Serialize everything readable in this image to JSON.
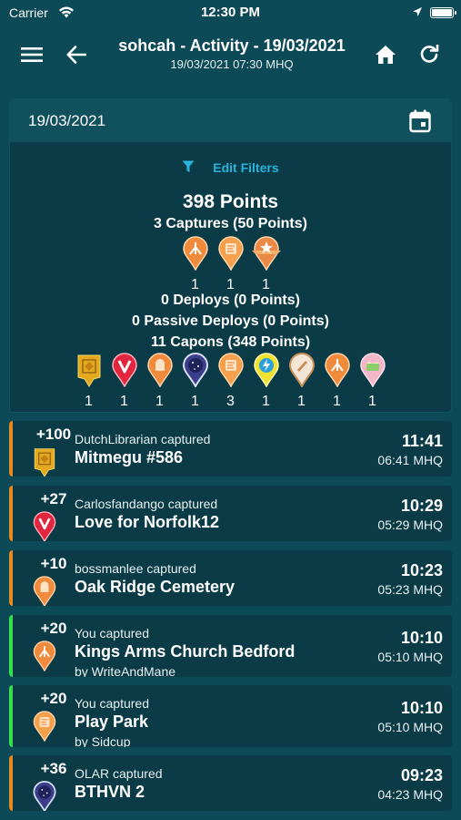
{
  "status_bar": {
    "carrier": "Carrier",
    "time": "12:30 PM"
  },
  "nav": {
    "title": "sohcah - Activity - 19/03/2021",
    "subtitle": "19/03/2021 07:30 MHQ"
  },
  "date_picker": {
    "value": "19/03/2021"
  },
  "filters": {
    "label": "Edit Filters"
  },
  "summary": {
    "total_points": "398 Points",
    "captures": "3 Captures (50 Points)",
    "capture_types": [
      {
        "icon": "orange-pin-icon",
        "count": "1"
      },
      {
        "icon": "orange-pin-flat-icon",
        "count": "1"
      },
      {
        "icon": "star-badge-pin-icon",
        "count": "1"
      }
    ],
    "deploys": "0 Deploys (0 Points)",
    "passive_deploys": "0 Passive Deploys (0 Points)",
    "capons": "11 Capons (348 Points)",
    "capon_types": [
      {
        "icon": "dutch-tile-icon",
        "count": "1"
      },
      {
        "icon": "red-v-pin-icon",
        "count": "1"
      },
      {
        "icon": "orange-pin-icon",
        "count": "1"
      },
      {
        "icon": "blue-star-pin-icon",
        "count": "1"
      },
      {
        "icon": "orange-pin-flat-icon",
        "count": "3"
      },
      {
        "icon": "lightning-pin-icon",
        "count": "1"
      },
      {
        "icon": "pencil-pin-icon",
        "count": "1"
      },
      {
        "icon": "orange-pin-icon",
        "count": "1"
      },
      {
        "icon": "cake-pin-icon",
        "count": "1"
      }
    ]
  },
  "activities": [
    {
      "points": "+100",
      "user": "DutchLibrarian captured",
      "name": "Mitmegu #586",
      "by": "",
      "time": "11:41",
      "mhq": "06:41 MHQ",
      "bar": "#e8881f",
      "icon": "dutch-tile-icon"
    },
    {
      "points": "+27",
      "user": "Carlosfandango captured",
      "name": "Love for Norfolk12",
      "by": "",
      "time": "10:29",
      "mhq": "05:29 MHQ",
      "bar": "#e8881f",
      "icon": "red-v-pin-icon"
    },
    {
      "points": "+10",
      "user": "bossmanlee captured",
      "name": "Oak Ridge Cemetery",
      "by": "",
      "time": "10:23",
      "mhq": "05:23 MHQ",
      "bar": "#e8881f",
      "icon": "orange-pin-icon"
    },
    {
      "points": "+20",
      "user": "You captured",
      "name": "Kings Arms Church Bedford",
      "by": "by WriteAndMane",
      "time": "10:10",
      "mhq": "05:10 MHQ",
      "bar": "#33e04a",
      "icon": "orange-pin-icon"
    },
    {
      "points": "+20",
      "user": "You captured",
      "name": "Play Park",
      "by": "by Sidcup",
      "time": "10:10",
      "mhq": "05:10 MHQ",
      "bar": "#33e04a",
      "icon": "orange-pin-flat-icon"
    },
    {
      "points": "+36",
      "user": "OLAR captured",
      "name": "BTHVN 2",
      "by": "",
      "time": "09:23",
      "mhq": "04:23 MHQ",
      "bar": "#e8881f",
      "icon": "blue-star-pin-icon"
    }
  ]
}
